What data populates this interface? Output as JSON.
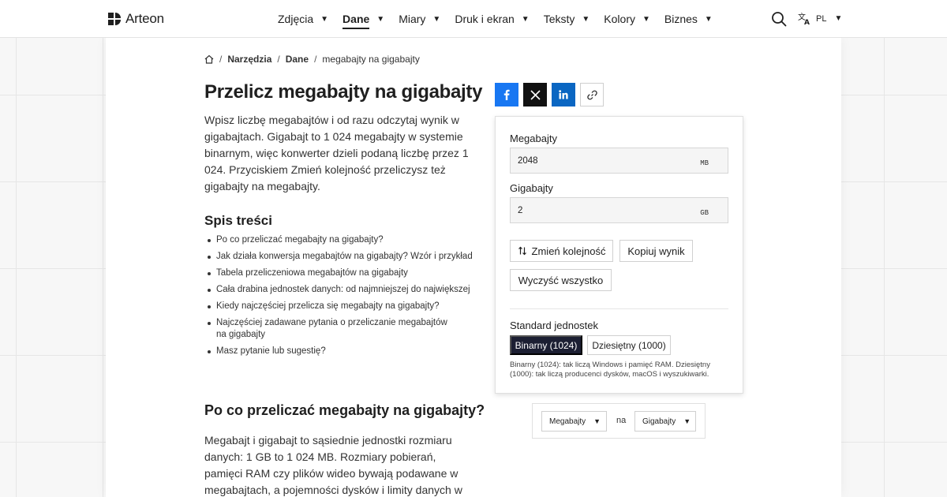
{
  "brand": {
    "name": "Arteon"
  },
  "nav": {
    "items": [
      {
        "label": "Zdjęcia",
        "active": false
      },
      {
        "label": "Dane",
        "active": true
      },
      {
        "label": "Miary",
        "active": false
      },
      {
        "label": "Druk i ekran",
        "active": false
      },
      {
        "label": "Teksty",
        "active": false
      },
      {
        "label": "Kolory",
        "active": false
      },
      {
        "label": "Biznes",
        "active": false
      }
    ],
    "caret": "▼"
  },
  "header": {
    "lang": "PL"
  },
  "breadcrumb": {
    "items": [
      "Narzędzia",
      "Dane",
      "megabajty na gigabajty"
    ],
    "sep": "/"
  },
  "page": {
    "title": "Przelicz megabajty na gigabajty",
    "intro": "Wpisz liczbę megabajtów i od razu odczytaj wynik w gigabajtach. Gigabajt to 1 024 megabajty w systemie binarnym, więc konwerter dzieli podaną liczbę przez 1 024. Przyciskiem Zmień kolejność przeliczysz też gigabajty na megabajty.",
    "toc_title": "Spis treści",
    "toc": [
      "Po co przeliczać megabajty na gigabajty?",
      "Jak działa konwersja megabajtów na gigabajty? Wzór i przykład",
      "Tabela przeliczeniowa megabajtów na gigabajty",
      "Cała drabina jednostek danych: od najmniejszej do największej",
      "Kiedy najczęściej przelicza się megabajty na gigabajty?",
      "Najczęściej zadawane pytania o przeliczanie megabajtów na gigabajty",
      "Masz pytanie lub sugestię?"
    ],
    "h2": "Po co przeliczać megabajty na gigabajty?",
    "body2": "Megabajt i gigabajt to sąsiednie jednostki rozmiaru danych: 1 GB to 1 024 MB. Rozmiary pobierań, pamięci RAM czy plików wideo bywają podawane w megabajtach, a pojemności dysków i limity danych w gigabajtach —"
  },
  "converter": {
    "from_label": "Megabajty",
    "from_value": "2048",
    "from_unit": "MB",
    "to_label": "Gigabajty",
    "to_value": "2",
    "to_unit": "GB",
    "swap_label": "Zmień kolejność",
    "copy_label": "Kopiuj wynik",
    "clear_label": "Wyczyść wszystko",
    "standard_label": "Standard jednostek",
    "binary_label": "Binarny (1024)",
    "decimal_label": "Dziesiętny (1000)",
    "note": "Binarny (1024): tak liczą Windows i pamięć RAM. Dziesiętny (1000): tak liczą producenci dysków, macOS i wyszukiwarki."
  },
  "pickers": {
    "from": "Megabajty",
    "connector": "na",
    "to": "Gigabajty"
  },
  "colors": {
    "facebook": "#1877f2",
    "x": "#111111",
    "linkedin": "#0a66c2",
    "segment_active": "#1c1f33"
  }
}
